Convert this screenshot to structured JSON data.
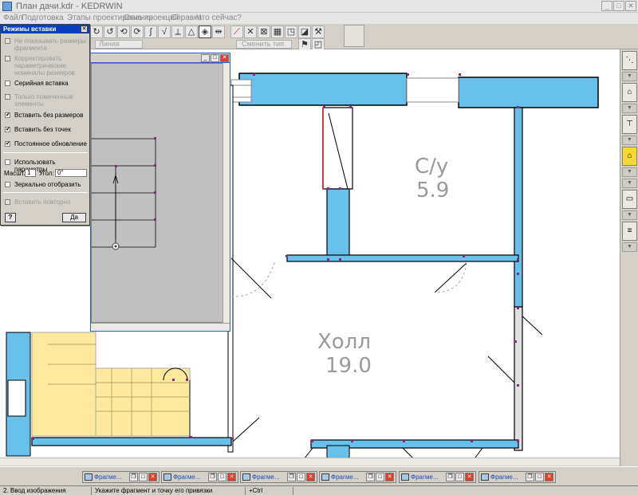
{
  "window": {
    "title": "План дачи.kdr - KEDRWIN",
    "minimize": "_",
    "maximize": "□",
    "close": "✕"
  },
  "menu": [
    "Файл",
    "Подготовка",
    "Этапы проектирования",
    "Окна проекций",
    "Справка",
    "Что сейчас?"
  ],
  "toolbar": {
    "line_type_left": "Линия основная",
    "line_type_right": "Сменить тип линии",
    "icons": [
      "rotate-icon",
      "rotate-alt-icon",
      "rotate-3-icon",
      "rotate-4-icon",
      "curve-icon",
      "snap-icon",
      "measure-icon",
      "mirror-icon",
      "snap-point-icon",
      "center-icon",
      "erase-red-icon",
      "cross-icon",
      "grid-cross-icon",
      "grid-icon",
      "stamp-icon",
      "paint-icon",
      "hammer-icon",
      "copy-icon",
      "dimension-icon",
      "flag-icon"
    ]
  },
  "dialog": {
    "title": "Режимы вставки",
    "close": "✕",
    "options": [
      {
        "label": "Не показывать размеры фрагмента",
        "checked": false,
        "enabled": false
      },
      {
        "label": "Корректировать параметрические номиналы размеров",
        "checked": false,
        "enabled": false
      },
      {
        "label": "Серийная вставка",
        "checked": false,
        "enabled": true
      },
      {
        "label": "Только помеченные элементы",
        "checked": false,
        "enabled": false
      },
      {
        "label": "Вставить без размеров",
        "checked": true,
        "enabled": true
      },
      {
        "label": "Вставить без точек",
        "checked": true,
        "enabled": true
      },
      {
        "label": "Постоянное обновление",
        "checked": true,
        "enabled": true
      }
    ],
    "use_params": {
      "label": "Использовать параметры",
      "checked": false
    },
    "scale_label": "Масшт.",
    "scale_value": "1",
    "angle_label": "Угол:",
    "angle_value": "0°",
    "mirror": {
      "label": "Зеркально отобразить",
      "checked": false
    },
    "repeat": {
      "label": "Вставить повторно",
      "checked": false,
      "enabled": false
    },
    "help_button": "?",
    "ok_button": "Да"
  },
  "fragment_window": {
    "minimize": "_",
    "maximize": "□",
    "close": "✕"
  },
  "plan": {
    "rooms": [
      {
        "name": "С/у",
        "area": "5.9"
      },
      {
        "name": "Холл",
        "area": "19.0"
      }
    ]
  },
  "taskbar": {
    "fragments": [
      {
        "label": "Фрагме..."
      },
      {
        "label": "Фрагме..."
      },
      {
        "label": "Фрагме..."
      },
      {
        "label": "Фрагме..."
      },
      {
        "label": "Фрагме..."
      },
      {
        "label": "Фрагме..."
      }
    ]
  },
  "status": {
    "mode": "2. Ввод изображения",
    "hint": "Укажите фрагмент и точку его привязки",
    "modifier": "+Ctrl"
  },
  "colors": {
    "wall_fill": "#69c0eb",
    "yellow_fill": "#ffeaa0",
    "accent": "#0a3ec0",
    "room_text": "#9a9a9a",
    "marker": "#8a2a7a"
  }
}
